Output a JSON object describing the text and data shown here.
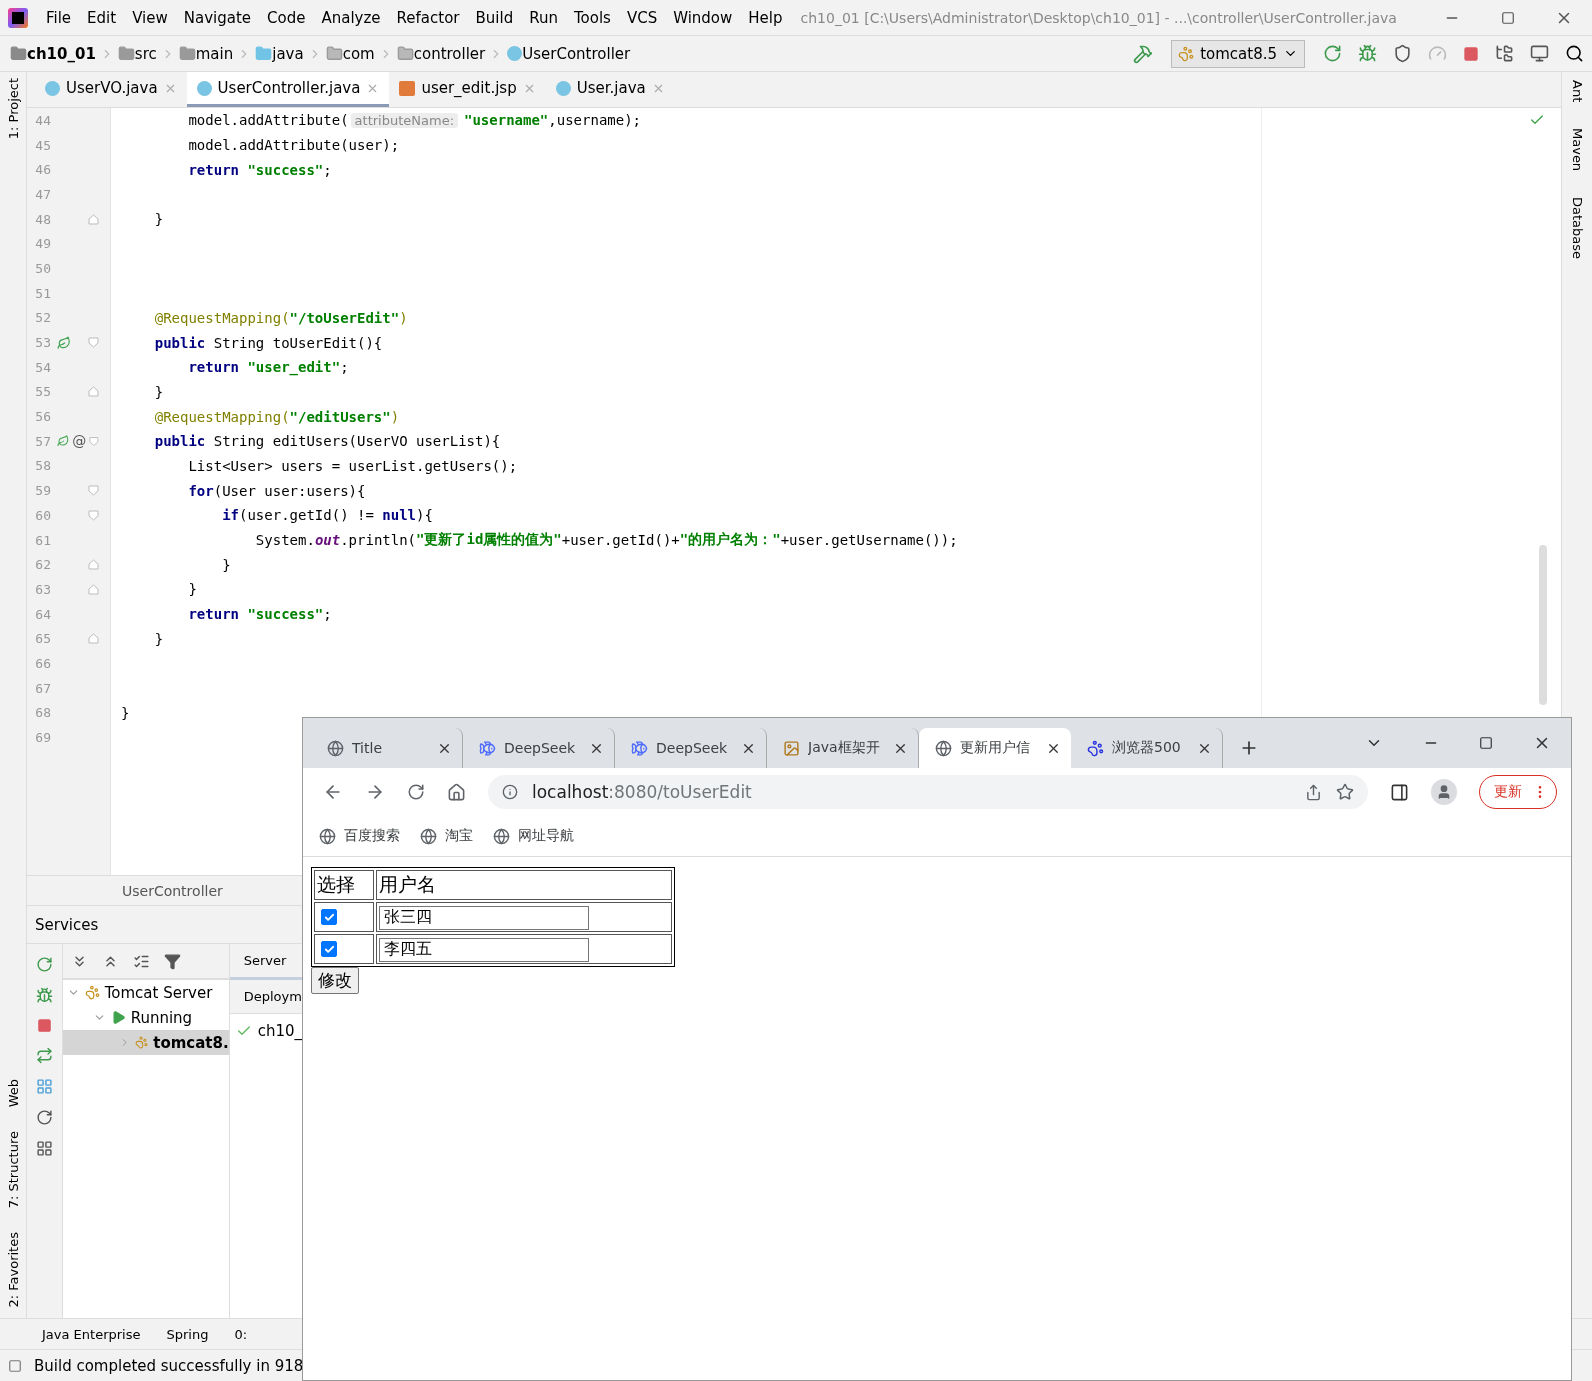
{
  "ide": {
    "title": "ch10_01 [C:\\Users\\Administrator\\Desktop\\ch10_01] - ...\\controller\\UserController.java",
    "menu": [
      "File",
      "Edit",
      "View",
      "Navigate",
      "Code",
      "Analyze",
      "Refactor",
      "Build",
      "Run",
      "Tools",
      "VCS",
      "Window",
      "Help"
    ],
    "breadcrumbs": [
      {
        "label": "ch10_01",
        "kind": "module"
      },
      {
        "label": "src",
        "kind": "folder"
      },
      {
        "label": "main",
        "kind": "folder"
      },
      {
        "label": "java",
        "kind": "source"
      },
      {
        "label": "com",
        "kind": "package"
      },
      {
        "label": "controller",
        "kind": "package"
      },
      {
        "label": "UserController",
        "kind": "class"
      }
    ],
    "run_config": "tomcat8.5",
    "file_tabs": [
      {
        "label": "UserVO.java",
        "kind": "class",
        "selected": false
      },
      {
        "label": "UserController.java",
        "kind": "class",
        "selected": true
      },
      {
        "label": "user_edit.jsp",
        "kind": "jsp",
        "selected": false
      },
      {
        "label": "User.java",
        "kind": "class",
        "selected": false
      }
    ],
    "code_lines": [
      {
        "n": "44",
        "tokens": [
          {
            "kind": "plain",
            "t": "        model.addAttribute("
          },
          {
            "kind": "hint",
            "t": "attributeName:"
          },
          {
            "kind": "str",
            "t": "\"username\""
          },
          {
            "kind": "plain",
            "t": ",username);"
          }
        ]
      },
      {
        "n": "45",
        "tokens": [
          {
            "kind": "plain",
            "t": "        model.addAttribute(user);"
          }
        ]
      },
      {
        "n": "46",
        "tokens": [
          {
            "kind": "kw",
            "t": "        return "
          },
          {
            "kind": "str",
            "t": "\"success\""
          },
          {
            "kind": "plain",
            "t": ";"
          }
        ]
      },
      {
        "n": "47"
      },
      {
        "n": "48",
        "fold_end": true,
        "tokens": [
          {
            "kind": "plain",
            "t": "    }"
          }
        ]
      },
      {
        "n": "49"
      },
      {
        "n": "50"
      },
      {
        "n": "51"
      },
      {
        "n": "52",
        "tokens": [
          {
            "kind": "ann",
            "t": "    @RequestMapping("
          },
          {
            "kind": "str",
            "t": "\"/toUserEdit\""
          },
          {
            "kind": "ann",
            "t": ")"
          }
        ]
      },
      {
        "n": "53",
        "fold_start": true,
        "run_icon": true,
        "tokens": [
          {
            "kind": "kw",
            "t": "    public "
          },
          {
            "kind": "plain",
            "t": "String toUserEdit(){"
          }
        ]
      },
      {
        "n": "54",
        "tokens": [
          {
            "kind": "kw",
            "t": "        return "
          },
          {
            "kind": "str",
            "t": "\"user_edit\""
          },
          {
            "kind": "plain",
            "t": ";"
          }
        ]
      },
      {
        "n": "55",
        "fold_end": true,
        "tokens": [
          {
            "kind": "plain",
            "t": "    }"
          }
        ]
      },
      {
        "n": "56",
        "tokens": [
          {
            "kind": "ann",
            "t": "    @RequestMapping("
          },
          {
            "kind": "str",
            "t": "\"/editUsers\""
          },
          {
            "kind": "ann",
            "t": ")"
          }
        ]
      },
      {
        "n": "57",
        "fold_start": true,
        "run_icon": true,
        "mark": "@",
        "tokens": [
          {
            "kind": "kw",
            "t": "    public "
          },
          {
            "kind": "plain",
            "t": "String editUsers(UserVO userList){"
          }
        ]
      },
      {
        "n": "58",
        "tokens": [
          {
            "kind": "plain",
            "t": "        List<User> users = userList.getUsers();"
          }
        ]
      },
      {
        "n": "59",
        "fold_start": true,
        "tokens": [
          {
            "kind": "kw",
            "t": "        for"
          },
          {
            "kind": "plain",
            "t": "(User user:users){"
          }
        ]
      },
      {
        "n": "60",
        "fold_start": true,
        "tokens": [
          {
            "kind": "kw",
            "t": "            if"
          },
          {
            "kind": "plain",
            "t": "(user.getId() != "
          },
          {
            "kind": "kw",
            "t": "null"
          },
          {
            "kind": "plain",
            "t": "){"
          }
        ]
      },
      {
        "n": "61",
        "tokens": [
          {
            "kind": "plain",
            "t": "                System."
          },
          {
            "kind": "static",
            "t": "out"
          },
          {
            "kind": "plain",
            "t": ".println("
          },
          {
            "kind": "str",
            "t": "\"更新了id属性的值为\""
          },
          {
            "kind": "plain",
            "t": "+user.getId()+"
          },
          {
            "kind": "str",
            "t": "\"的用户名为：\""
          },
          {
            "kind": "plain",
            "t": "+user.getUsername());"
          }
        ]
      },
      {
        "n": "62",
        "fold_end": true,
        "tokens": [
          {
            "kind": "plain",
            "t": "            }"
          }
        ]
      },
      {
        "n": "63",
        "fold_end": true,
        "tokens": [
          {
            "kind": "plain",
            "t": "        }"
          }
        ]
      },
      {
        "n": "64",
        "tokens": [
          {
            "kind": "kw",
            "t": "        return "
          },
          {
            "kind": "str",
            "t": "\"success\""
          },
          {
            "kind": "plain",
            "t": ";"
          }
        ]
      },
      {
        "n": "65",
        "fold_end": true,
        "tokens": [
          {
            "kind": "plain",
            "t": "    }"
          }
        ]
      },
      {
        "n": "66"
      },
      {
        "n": "67"
      },
      {
        "n": "68",
        "tokens": [
          {
            "kind": "plain",
            "t": "}"
          }
        ]
      },
      {
        "n": "69"
      }
    ],
    "editor_breadcrumb": "UserController",
    "left_strip": [
      "1: Project",
      "Web",
      "7: Structure",
      "2: Favorites"
    ],
    "right_strip": [
      "Ant",
      "Maven",
      "Database"
    ],
    "services": {
      "title": "Services",
      "tree": [
        {
          "label": "Tomcat Server",
          "kind": "server",
          "expanded": true,
          "selected": false,
          "children": [
            {
              "label": "Running",
              "kind": "status",
              "expanded": true,
              "selected": false,
              "children": [
                {
                  "label": "tomcat8.",
                  "kind": "server",
                  "expanded": false,
                  "selected": true
                }
              ]
            }
          ]
        }
      ],
      "detail_tabs": [
        "Server",
        "Deploym"
      ],
      "deployment": "ch10_"
    },
    "tool_windows": [
      "Java Enterprise",
      "Spring",
      "0:"
    ],
    "status": "Build completed successfully in 918"
  },
  "browser": {
    "tabs": [
      {
        "title": "Title",
        "kind": "web",
        "selected": false
      },
      {
        "title": "DeepSeek",
        "kind": "chat",
        "selected": false
      },
      {
        "title": "DeepSeek",
        "kind": "chat",
        "selected": false
      },
      {
        "title": "Java框架开",
        "kind": "article",
        "selected": false
      },
      {
        "title": "更新用户信",
        "kind": "web",
        "selected": true
      },
      {
        "title": "浏览器500",
        "kind": "search",
        "selected": false
      }
    ],
    "address_host": "localhost",
    "address_path": ":8080/toUserEdit",
    "update_button": "更新",
    "bookmarks": [
      "百度搜索",
      "淘宝",
      "网址导航"
    ],
    "page": {
      "headers": [
        "选择",
        "用户名"
      ],
      "rows": [
        {
          "checked": true,
          "name": "张三四"
        },
        {
          "checked": true,
          "name": "李四五"
        }
      ],
      "submit": "修改"
    }
  }
}
